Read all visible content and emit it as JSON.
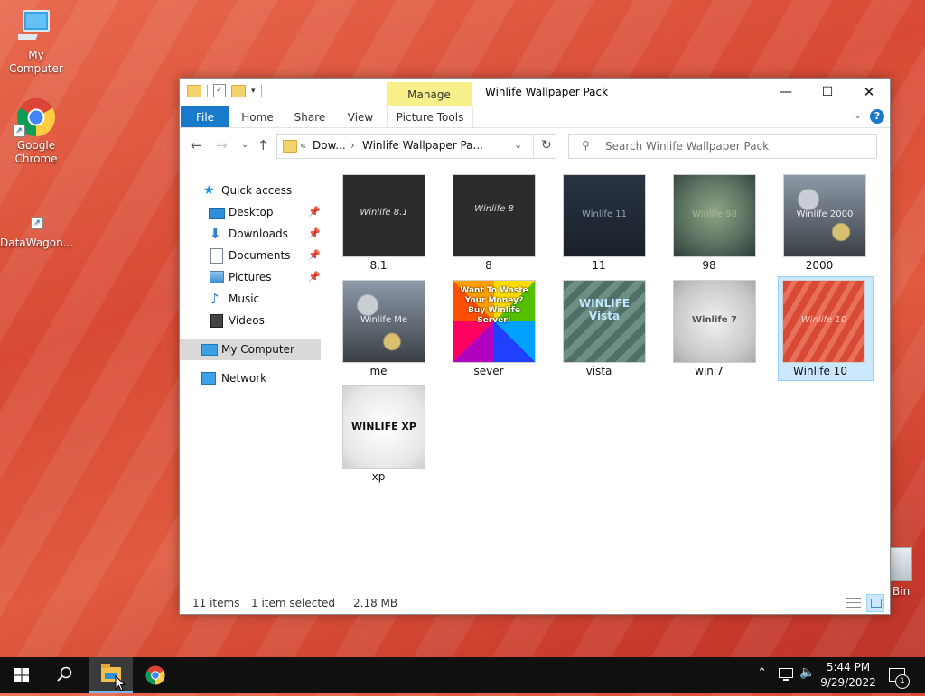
{
  "desktop": {
    "icons": [
      {
        "label": "My Computer"
      },
      {
        "label": "Google Chrome"
      },
      {
        "label": "DataWagon..."
      },
      {
        "label": "Bin"
      }
    ]
  },
  "window": {
    "title": "Winlife Wallpaper Pack",
    "context_tab": "Manage",
    "ribbon": {
      "tabs": [
        "File",
        "Home",
        "Share",
        "View"
      ],
      "context_group": "Picture Tools"
    },
    "controls": {
      "minimize": "—",
      "maximize": "☐",
      "close": "✕"
    },
    "address": {
      "prefix": "«",
      "crumb1": "Dow...",
      "separator": "›",
      "crumb2": "Winlife Wallpaper Pa..."
    },
    "search": {
      "placeholder": "Search Winlife Wallpaper Pack"
    },
    "nav": {
      "quick_access": "Quick access",
      "items": [
        {
          "label": "Desktop",
          "icon": "desktop-icon",
          "pinned": true
        },
        {
          "label": "Downloads",
          "icon": "downloads-icon",
          "pinned": true
        },
        {
          "label": "Documents",
          "icon": "documents-icon",
          "pinned": true
        },
        {
          "label": "Pictures",
          "icon": "pictures-icon",
          "pinned": true
        },
        {
          "label": "Music",
          "icon": "music-icon",
          "pinned": false
        },
        {
          "label": "Videos",
          "icon": "videos-icon",
          "pinned": false
        }
      ],
      "my_computer": "My Computer",
      "network": "Network"
    },
    "files": [
      {
        "name": "8.1",
        "thumb_text": "Winlife 8.1",
        "style": "dark-arc"
      },
      {
        "name": "8",
        "thumb_text": "Winlife 8",
        "style": "dark-arc"
      },
      {
        "name": "11",
        "thumb_text": "Winlife 11",
        "style": "navy"
      },
      {
        "name": "98",
        "thumb_text": "Winlife 98",
        "style": "teal"
      },
      {
        "name": "2000",
        "thumb_text": "Winlife 2000",
        "style": "bokeh"
      },
      {
        "name": "me",
        "thumb_text": "Winlife Me",
        "style": "bokeh"
      },
      {
        "name": "sever",
        "thumb_text": "Want To Waste Your Money? Buy Winlife Server!",
        "style": "pinwheel"
      },
      {
        "name": "vista",
        "thumb_text": "WINLIFE Vista",
        "style": "stripes-teal"
      },
      {
        "name": "winl7",
        "thumb_text": "Winlife 7",
        "style": "silver"
      },
      {
        "name": "Winlife 10",
        "thumb_text": "Winlife 10",
        "style": "red-stripes",
        "selected": true
      },
      {
        "name": "xp",
        "thumb_text": "WINLIFE XP",
        "style": "white"
      }
    ],
    "status": {
      "count": "11 items",
      "selection": "1 item selected",
      "size": "2.18 MB"
    }
  },
  "taskbar": {
    "time": "5:44 PM",
    "date": "9/29/2022",
    "notification_count": "1"
  },
  "colors": {
    "accent": "#1979ca",
    "manage_tab": "#f8f08a",
    "selection_bg": "#cce8ff",
    "selection_border": "#99d1ff"
  }
}
